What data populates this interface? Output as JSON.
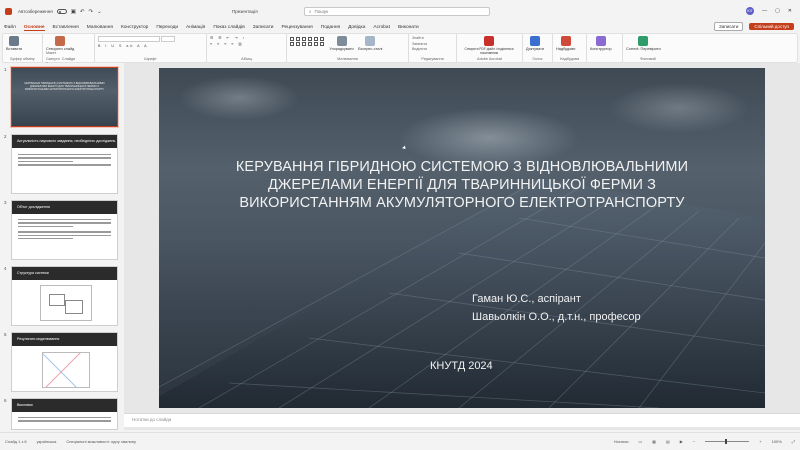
{
  "titlebar": {
    "autosave": "Автозбереження",
    "document_title": "Презентація",
    "search_placeholder": "Пошук",
    "user_initials": "ЮГ"
  },
  "tabs": [
    "Файл",
    "Основне",
    "Вставлення",
    "Малювання",
    "Конструктор",
    "Переходи",
    "Анімація",
    "Показ слайдів",
    "Записати",
    "Рецензування",
    "Подання",
    "Довідка",
    "Acrobat",
    "Виконати"
  ],
  "active_tab": "Основне",
  "tab_actions": {
    "record": "Записати",
    "share": "Спільний доступ"
  },
  "ribbon": {
    "clipboard": {
      "paste": "Вставити",
      "label": "Буфер обміну"
    },
    "slides": {
      "new_slide": "Створити слайд",
      "layout": "Макет",
      "reset": "Скинути",
      "section": "Розділ",
      "label": "Слайди"
    },
    "font": {
      "label": "Шрифт"
    },
    "paragraph": {
      "label": "Абзац"
    },
    "drawing": {
      "arrange": "Упорядкувати",
      "quick_styles": "Експрес-стилі",
      "label": "Малювання"
    },
    "editing": {
      "find": "Знайти",
      "replace": "Замінити",
      "select": "Виділити",
      "label": "Редагування"
    },
    "acrobat": {
      "create_pdf": "Створити PDF-файл і поділитися посиланням",
      "label": "Adobe Acrobat"
    },
    "voice": {
      "dictate": "Диктувати",
      "label": "Голос"
    },
    "addins": {
      "addins": "Надбудови",
      "label": "Надбудови"
    },
    "designer": {
      "designer": "Конструктор"
    },
    "proofing": {
      "correct": "Correct: Перевірити",
      "label": "Фоновий"
    }
  },
  "thumbnails": [
    {
      "num": "1",
      "title": "КЕРУВАННЯ ГІБРИДНОЮ СИСТЕМОЮ З ВІДНОВЛЮВАЛЬНИМИ ДЖЕРЕЛАМИ ЕНЕРГІЇ ДЛЯ ТВАРИННИЦЬКОЇ ФЕРМИ З ВИКОРИСТАННЯМ АКУМУЛЯТОРНОГО ЕЛЕКТРОТРАНСПОРТУ"
    },
    {
      "num": "2",
      "title": "Актуальність наукового завдання, необхідність досліджень"
    },
    {
      "num": "3",
      "title": "Об'єкт дослідження"
    },
    {
      "num": "4",
      "title": "Структура системи"
    },
    {
      "num": "5",
      "title": "Результати моделювання"
    },
    {
      "num": "6",
      "title": "Висновки"
    }
  ],
  "slide": {
    "title": "КЕРУВАННЯ ГІБРИДНОЮ СИСТЕМОЮ З ВІДНОВЛЮВАЛЬНИМИ ДЖЕРЕЛАМИ ЕНЕРГІЇ ДЛЯ ТВАРИННИЦЬКОЇ ФЕРМИ З ВИКОРИСТАННЯМ АКУМУЛЯТОРНОГО ЕЛЕКТРОТРАНСПОРТУ",
    "author1": "Гаман Ю.С., аспірант",
    "author2": "Шавьолкін О.О., д.т.н., професор",
    "footer": "КНУТД 2024"
  },
  "notes_placeholder": "Нотатки до слайда",
  "status": {
    "slide_counter": "Слайд 1 з 6",
    "language": "українська",
    "accessibility": "Спеціальні можливості: одну хвилину",
    "notes": "Нотатки",
    "zoom": "100%"
  },
  "colors": {
    "accent": "#c43e1c"
  }
}
